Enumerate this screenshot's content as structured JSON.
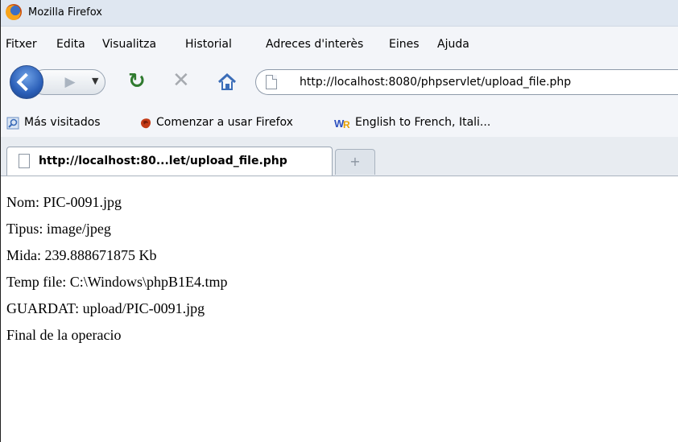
{
  "window": {
    "title": "Mozilla Firefox"
  },
  "menu": {
    "items": [
      "Fitxer",
      "Edita",
      "Visualitza",
      "Historial",
      "Adreces d'interès",
      "Eines",
      "Ajuda"
    ]
  },
  "navigation": {
    "url": "http://localhost:8080/phpservlet/upload_file.php"
  },
  "bookmarks": {
    "items": [
      {
        "label": "Más visitados",
        "icon": "search-bookmark-icon"
      },
      {
        "label": "Comenzar a usar Firefox",
        "icon": "firefox-start-icon"
      },
      {
        "label": "English to French, Itali...",
        "icon": "wordreference-icon"
      }
    ]
  },
  "tabs": {
    "active_label": "http://localhost:80...let/upload_file.php",
    "new_tab_symbol": "+"
  },
  "content": {
    "lines": [
      "Nom: PIC-0091.jpg",
      "Tipus: image/jpeg",
      "Mida: 239.888671875 Kb",
      "Temp file: C:\\Windows\\phpB1E4.tmp",
      "GUARDAT: upload/PIC-0091.jpg",
      "Final de la operacio"
    ]
  },
  "colors": {
    "titlebar": "#dfe7f1",
    "toolbar": "#f3f5f9",
    "back_button": "#2b5fb8",
    "reload": "#2f7a2f"
  }
}
